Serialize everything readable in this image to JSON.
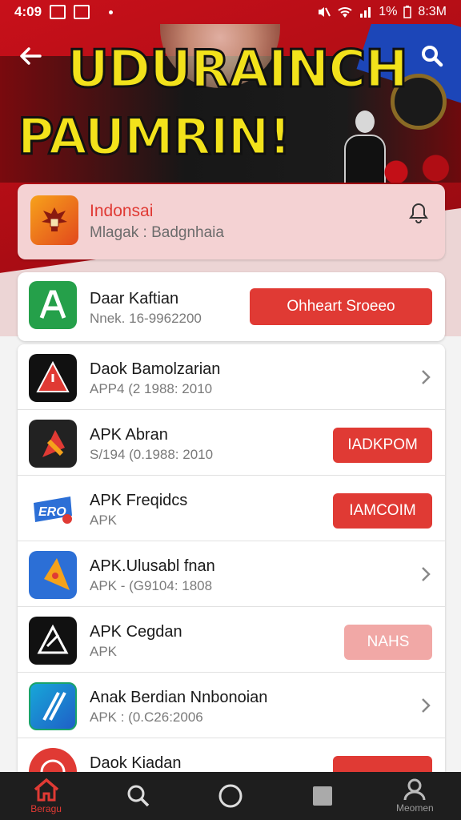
{
  "status_bar": {
    "time": "4:09",
    "battery": "1%",
    "clock_right": "8:3M"
  },
  "header": {
    "headline_1": "UDURAINCH",
    "headline_2": "PAUMRIN!"
  },
  "featured": {
    "title": "Indonsai",
    "subtitle": "Mlagak : Badgnhaia",
    "icon": "garuda-icon"
  },
  "first_item": {
    "name": "Daar Kaftian",
    "subtitle": "Nnek. 16-9962200",
    "button": "Ohheart Sroeeo"
  },
  "apps": [
    {
      "name": "Daok Bamolzarian",
      "subtitle": "APP4 (2 1988: 2010",
      "action": "chevron",
      "icon_color": "#1b1b1b"
    },
    {
      "name": "APK Abran",
      "subtitle": "S/194 (0.1988: 2010",
      "action": "button",
      "button": "IADKPOM",
      "icon_color": "#1b1b1b"
    },
    {
      "name": "APK Freqidcs",
      "subtitle": "APK",
      "action": "button",
      "button": "IAMCOIM",
      "icon_color": "#ffffff"
    },
    {
      "name": "APK.Ulusabl fnan",
      "subtitle": "APK - (G9104: 1808",
      "action": "chevron",
      "icon_color": "#2c6fd6"
    },
    {
      "name": "APK Cegdan",
      "subtitle": "APK",
      "action": "button_light",
      "button": "NAHS",
      "icon_color": "#1b1b1b"
    },
    {
      "name": "Anak Berdian Nnbonoian",
      "subtitle": "APK : (0.C26:2006",
      "action": "chevron",
      "icon_color": "#1f8fd0"
    },
    {
      "name": "Daok Kiadan",
      "subtitle": "",
      "action": "button",
      "button": "",
      "icon_color": "#e03a34"
    }
  ],
  "nav": {
    "home_label": "Beragu",
    "profile_label": "Meomen"
  },
  "colors": {
    "accent": "#e03a34",
    "header_red": "#c8101a",
    "headline_yellow": "#f2e21b",
    "nav_bg": "#1e1e1e"
  }
}
